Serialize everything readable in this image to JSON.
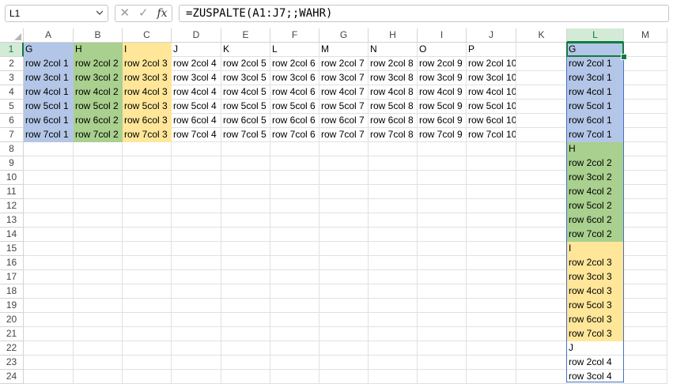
{
  "namebox": {
    "value": "L1"
  },
  "formula_bar": {
    "cancel_icon": "✕",
    "enter_icon": "✓",
    "fx_icon": "fx",
    "formula": "=ZUSPALTE(A1:J7;;WAHR)"
  },
  "columns": [
    "A",
    "B",
    "C",
    "D",
    "E",
    "F",
    "G",
    "H",
    "I",
    "J",
    "K",
    "L",
    "M"
  ],
  "rows": [
    "1",
    "2",
    "3",
    "4",
    "5",
    "6",
    "7",
    "8",
    "9",
    "10",
    "11",
    "12",
    "13",
    "14",
    "15",
    "16",
    "17",
    "18",
    "19",
    "20",
    "21",
    "22",
    "23",
    "24"
  ],
  "source_table": [
    [
      "G",
      "H",
      "I",
      "J",
      "K",
      "L",
      "M",
      "N",
      "O",
      "P"
    ],
    [
      "row 2col 1",
      "row 2col 2",
      "row 2col 3",
      "row 2col 4",
      "row 2col 5",
      "row 2col 6",
      "row 2col 7",
      "row 2col 8",
      "row 2col 9",
      "row 2col 10"
    ],
    [
      "row 3col 1",
      "row 3col 2",
      "row 3col 3",
      "row 3col 4",
      "row 3col 5",
      "row 3col 6",
      "row 3col 7",
      "row 3col 8",
      "row 3col 9",
      "row 3col 10"
    ],
    [
      "row 4col 1",
      "row 4col 2",
      "row 4col 3",
      "row 4col 4",
      "row 4col 5",
      "row 4col 6",
      "row 4col 7",
      "row 4col 8",
      "row 4col 9",
      "row 4col 10"
    ],
    [
      "row 5col 1",
      "row 5col 2",
      "row 5col 3",
      "row 5col 4",
      "row 5col 5",
      "row 5col 6",
      "row 5col 7",
      "row 5col 8",
      "row 5col 9",
      "row 5col 10"
    ],
    [
      "row 6col 1",
      "row 6col 2",
      "row 6col 3",
      "row 6col 4",
      "row 6col 5",
      "row 6col 6",
      "row 6col 7",
      "row 6col 8",
      "row 6col 9",
      "row 6col 10"
    ],
    [
      "row 7col 1",
      "row 7col 2",
      "row 7col 3",
      "row 7col 4",
      "row 7col 5",
      "row 7col 6",
      "row 7col 7",
      "row 7col 8",
      "row 7col 9",
      "row 7col 10"
    ]
  ],
  "spill_column": [
    "G",
    "row 2col 1",
    "row 3col 1",
    "row 4col 1",
    "row 5col 1",
    "row 6col 1",
    "row 7col 1",
    "H",
    "row 2col 2",
    "row 3col 2",
    "row 4col 2",
    "row 5col 2",
    "row 6col 2",
    "row 7col 2",
    "I",
    "row 2col 3",
    "row 3col 3",
    "row 4col 3",
    "row 5col 3",
    "row 6col 3",
    "row 7col 3",
    "J",
    "row 2col 4",
    "row 3col 4"
  ],
  "colors": {
    "blue": "#b4c6e7",
    "green": "#a9d08e",
    "yellow": "#ffe699",
    "accent": "#107c41",
    "spill_border": "#4472c4"
  },
  "active_cell": "L1"
}
